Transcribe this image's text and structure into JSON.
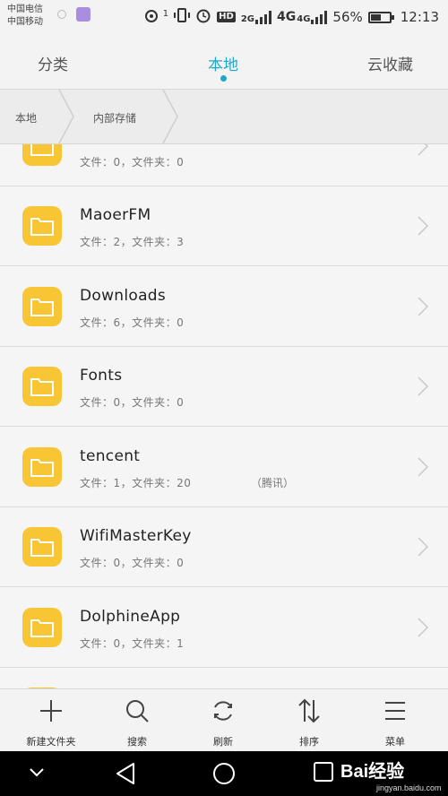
{
  "status_bar": {
    "carrier_1": "中国电信",
    "carrier_2": "中国移动",
    "sim_badge": "1",
    "hd_label": "HD",
    "net_2g": "2G",
    "net_4g_a": "4G",
    "net_4g_b": "4G",
    "battery_percent": "56%",
    "battery_level": 0.56,
    "time": "12:13"
  },
  "tabs": [
    {
      "label": "分类",
      "active": false
    },
    {
      "label": "本地",
      "active": true
    },
    {
      "label": "云收藏",
      "active": false
    }
  ],
  "breadcrumb": [
    "本地",
    "内部存储"
  ],
  "folders": [
    {
      "name": "",
      "meta": "文件：0，文件夹：0",
      "tag": ""
    },
    {
      "name": "MaoerFM",
      "meta": "文件：2，文件夹：3",
      "tag": ""
    },
    {
      "name": "Downloads",
      "meta": "文件：6，文件夹：0",
      "tag": ""
    },
    {
      "name": "Fonts",
      "meta": "文件：0，文件夹：0",
      "tag": ""
    },
    {
      "name": "tencent",
      "meta": "文件：1，文件夹：20",
      "tag": "（腾讯）"
    },
    {
      "name": "WifiMasterKey",
      "meta": "文件：0，文件夹：0",
      "tag": ""
    },
    {
      "name": "DolphineApp",
      "meta": "文件：0，文件夹：1",
      "tag": ""
    }
  ],
  "toolbar": {
    "new_folder": "新建文件夹",
    "search": "搜索",
    "refresh": "刷新",
    "sort": "排序",
    "menu": "菜单"
  },
  "watermark": {
    "brand": "Bai经验",
    "url": "jingyan.baidu.com"
  },
  "colors": {
    "accent": "#22a7c9",
    "folder": "#f8c535"
  }
}
